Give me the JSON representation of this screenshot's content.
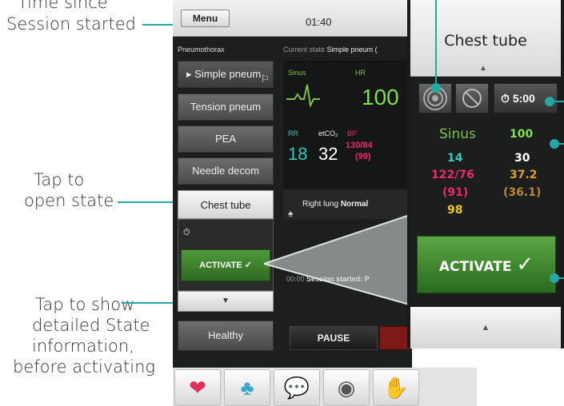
{
  "annotations": {
    "time_top": "Time since",
    "time_bottom": "Session started",
    "tap_open_1": "Tap to",
    "tap_open_2": "open state",
    "tap_show_1": "Tap to show",
    "tap_show_2": "detailed State",
    "tap_show_3": "information,",
    "tap_show_4": "before activating"
  },
  "topbar": {
    "menu_label": "Menu",
    "elapsed": "01:40"
  },
  "scenario": {
    "name": "Pneumothorax",
    "states": [
      {
        "label": "Simple pneum"
      },
      {
        "label": "Tension pneum"
      },
      {
        "label": "PEA"
      },
      {
        "label": "Needle decom"
      },
      {
        "label": "Chest tube"
      }
    ],
    "activate_label": "ACTIVATE ✓",
    "healthy_label": "Healthy"
  },
  "monitor": {
    "current_state_label": "Current state",
    "current_state_value": "Simple pneum (",
    "rhythm_label": "Sinus",
    "hr_label": "HR",
    "hr": "100",
    "rr_label": "RR",
    "rr": "18",
    "etco2_label": "etCO₂",
    "etco2": "32",
    "bp_label": "BP",
    "bp": "130/84",
    "map": "(99)",
    "lung_label": "Right lung",
    "lung_value": "Normal",
    "log_time": "00:00",
    "log_text": "Session started: P",
    "pause_label": "PAUSE"
  },
  "zoom": {
    "title": "Chest tube",
    "timer": "5:00",
    "rhythm": "Sinus",
    "hr": "100",
    "rr": "14",
    "etco2": "30",
    "bp": "122/76",
    "temp": "37.2",
    "map": "(91)",
    "temp2": "(36.1)",
    "spo2": "98",
    "activate_label": "ACTIVATE"
  },
  "colors": {
    "accent": "#23a8a4",
    "sinus_green": "#7fc241",
    "hr_green": "#7fe04a",
    "rr_cyan": "#38c7c0",
    "bp_pink": "#ee2a6b",
    "temp_orange": "#e0a030",
    "spo2_yellow": "#f2c81c"
  }
}
